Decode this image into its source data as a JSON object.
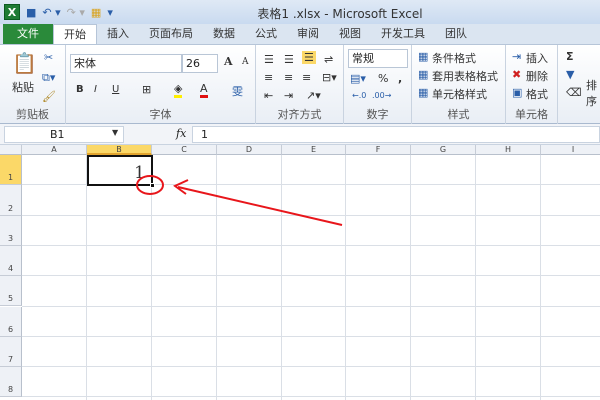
{
  "window": {
    "title": "表格1 .xlsx - Microsoft Excel",
    "app_icon": "X"
  },
  "tabs": [
    "文件",
    "开始",
    "插入",
    "页面布局",
    "数据",
    "公式",
    "审阅",
    "视图",
    "开发工具",
    "团队"
  ],
  "ribbon": {
    "clipboard": {
      "paste": "粘贴",
      "label": "剪贴板"
    },
    "font": {
      "name": "宋体",
      "size": "26",
      "bold": "B",
      "italic": "I",
      "underline": "U",
      "grow": "A",
      "shrink": "A",
      "color": "A",
      "phonetic": "雯",
      "label": "字体"
    },
    "alignment": {
      "label": "对齐方式"
    },
    "number": {
      "format": "常规",
      "percent": "%",
      "comma": ",",
      "label": "数字"
    },
    "styles": {
      "conditional": "条件格式",
      "table": "套用表格格式",
      "cell": "单元格样式",
      "label": "样式"
    },
    "cells": {
      "insert": "插入",
      "delete": "删除",
      "format": "格式",
      "label": "单元格"
    },
    "editing": {
      "sum": "Σ",
      "sort": "排序"
    }
  },
  "formula_bar": {
    "name_box": "B1",
    "fx": "fx",
    "value": "1"
  },
  "sheet": {
    "columns": [
      "A",
      "B",
      "C",
      "D",
      "E",
      "F",
      "G",
      "H",
      "I"
    ],
    "rows": [
      "1",
      "2",
      "3",
      "4",
      "5",
      "6",
      "7",
      "8"
    ],
    "selected": "B1",
    "cells": {
      "B1": "1"
    }
  },
  "colors": {
    "file_tab": "#2a8a3a",
    "selection_header": "#fbd868",
    "annotation": "#e8161b"
  }
}
